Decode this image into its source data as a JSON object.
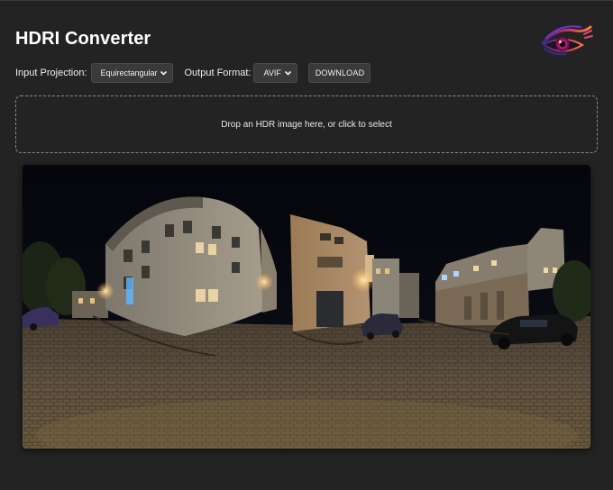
{
  "app": {
    "title": "HDRI Converter"
  },
  "controls": {
    "input_projection_label": "Input Projection:",
    "input_projection_value": "Equirectangular",
    "output_format_label": "Output Format:",
    "output_format_value": "AVIF",
    "download_label": "DOWNLOAD"
  },
  "dropzone": {
    "text": "Drop an HDR image here, or click to select"
  },
  "icons": {
    "logo": "eye-logo-icon",
    "select_chevron": "chevron-down-icon"
  },
  "colors": {
    "background": "#232323",
    "control_bg": "#3a3a3a",
    "dropzone_border": "#8a8a8a",
    "logo_accent": "#c0306f"
  }
}
